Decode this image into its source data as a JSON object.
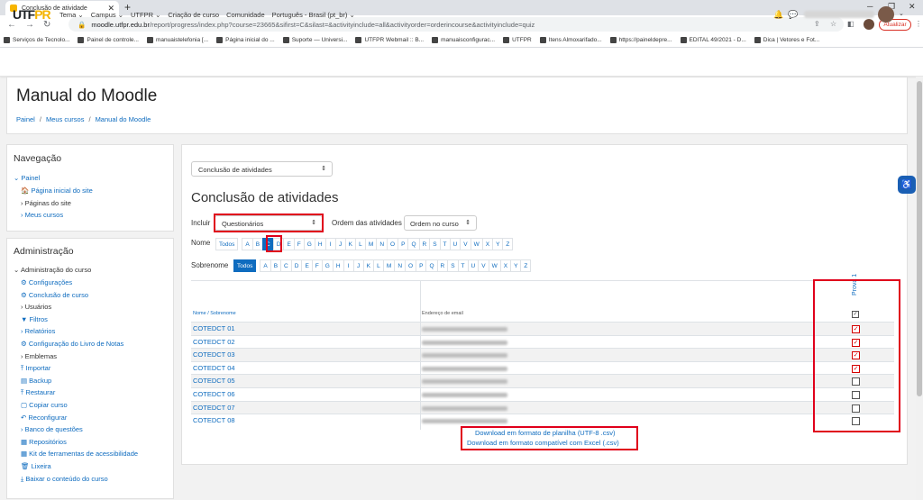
{
  "browser": {
    "tab_title": "Conclusão de atividade",
    "tab_close": "✕",
    "new_tab": "+",
    "url_host": "moodle.utfpr.edu.br",
    "url_path": "/report/progress/index.php?course=23665&sifirst=C&silast=&activityinclude=all&activityorder=orderincourse&activityinclude=quiz",
    "update_label": "Atualizar",
    "bookmarks": [
      "Serviços de Tecnolo...",
      "Painel de controle...",
      "manuaistelefonia [...",
      "Página inicial do ...",
      "Suporte — Universi...",
      "UTFPR Webmail :: B...",
      "manuaisconfigurac...",
      "UTFPR",
      "Itens Almoxarifado...",
      "https://painel​depre...",
      "EDITAL 49/2021 - D...",
      "Dica | Vetores e Fot..."
    ]
  },
  "nav": {
    "logo_a": "UTF",
    "logo_b": "PR",
    "menu": [
      "Tema ⌄",
      "Campus ⌄",
      "UTFPR ⌄",
      "Criação de curso",
      "Comunidade",
      "Português - Brasil (pt_br) ⌄"
    ]
  },
  "header": {
    "title": "Manual do Moodle",
    "crumbs": [
      "Painel",
      "Meus cursos",
      "Manual do Moodle"
    ]
  },
  "navigation": {
    "title": "Navegação",
    "items": [
      "Painel",
      "Página inicial do site",
      "Páginas do site",
      "Meus cursos"
    ]
  },
  "admin": {
    "title": "Administração",
    "root": "Administração do curso",
    "items": [
      "Configurações",
      "Conclusão de curso",
      "Usuários",
      "Filtros",
      "Relatórios",
      "Configuração do Livro de Notas",
      "Emblemas",
      "Importar",
      "Backup",
      "Restaurar",
      "Copiar curso",
      "Reconfigurar",
      "Banco de questões",
      "Repositórios",
      "Kit de ferramentas de acessibilidade",
      "Lixeira",
      "Baixar o conteúdo do curso"
    ]
  },
  "main": {
    "report_select": "Conclusão de atividades",
    "heading": "Conclusão de atividades",
    "incluir_label": "Incluir",
    "incluir_value": "Questionários",
    "ordem_label": "Ordem das atividades",
    "ordem_value": "Ordem no curso",
    "nome_label": "Nome",
    "sobrenome_label": "Sobrenome",
    "all_label": "Todos",
    "letters": [
      "A",
      "B",
      "C",
      "D",
      "E",
      "F",
      "G",
      "H",
      "I",
      "J",
      "K",
      "L",
      "M",
      "N",
      "O",
      "P",
      "Q",
      "R",
      "S",
      "T",
      "U",
      "V",
      "W",
      "X",
      "Y",
      "Z"
    ],
    "selected_first_letter": "C",
    "th_nome": "Nome",
    "th_sep": " / Sobrenome",
    "th_email": "Endereço de email",
    "activity": "Prova 1",
    "students": [
      {
        "name": "COTEDCT 01",
        "done": true
      },
      {
        "name": "COTEDCT 02",
        "done": true
      },
      {
        "name": "COTEDCT 03",
        "done": true
      },
      {
        "name": "COTEDCT 04",
        "done": true
      },
      {
        "name": "COTEDCT 05",
        "done": false
      },
      {
        "name": "COTEDCT 06",
        "done": false
      },
      {
        "name": "COTEDCT 07",
        "done": false
      },
      {
        "name": "COTEDCT 08",
        "done": false
      }
    ],
    "download_csv": "Download em formato de planilha (UTF-8 .csv)",
    "download_excel": "Download em formato compatível com Excel (.csv)"
  },
  "colors": {
    "accent": "#0f6cbf",
    "highlight": "#e0001b"
  }
}
